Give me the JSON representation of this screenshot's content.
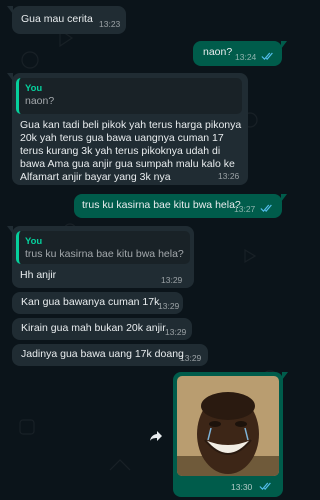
{
  "messages": [
    {
      "text": "Gua mau cerita",
      "time": "13:23"
    },
    {
      "text": "naon?",
      "time": "13:24"
    },
    {
      "quote_name": "You",
      "quote_text": "naon?",
      "text": "Gua kan tadi beli pikok yah terus harga pikonya 20k yah terus gua bawa uangnya cuman 17 terus kurang 3k yah terus pikoknya udah di bawa Ama gua anjir gua sumpah malu kalo ke Alfamart anjir bayar yang 3k nya",
      "time": "13:26"
    },
    {
      "text": "trus ku kasirna bae kitu bwa hela?",
      "time": "13:27"
    },
    {
      "quote_name": "You",
      "quote_text": "trus ku kasirna bae kitu bwa hela?",
      "text": "Hh anjir",
      "time": "13:29"
    },
    {
      "text": "Kan gua bawanya cuman 17k",
      "time": "13:29"
    },
    {
      "text": "Kirain gua mah bukan 20k anjir",
      "time": "13:29"
    },
    {
      "text": "Jadinya gua bawa uang 17k doang",
      "time": "13:29"
    },
    {
      "image": "laughing-man-photo",
      "time": "13:30"
    }
  ],
  "colors": {
    "background": "#0b141a",
    "incoming": "#202c33",
    "outgoing": "#005c4b",
    "quote_accent": "#06cf9c",
    "read_ticks": "#53bdeb"
  }
}
